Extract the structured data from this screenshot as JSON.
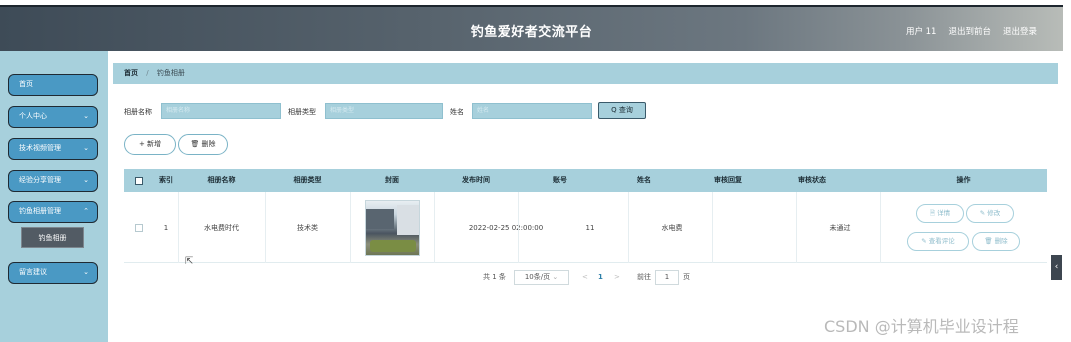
{
  "header": {
    "title": "钓鱼爱好者交流平台",
    "user": "用户 11",
    "back_to_front": "退出到前台",
    "logout": "退出登录"
  },
  "sidebar": {
    "items": [
      {
        "label": "首页",
        "chevron": ""
      },
      {
        "label": "个人中心",
        "chevron": "⌄"
      },
      {
        "label": "技术视频管理",
        "chevron": "⌄"
      },
      {
        "label": "经验分享管理",
        "chevron": "⌄"
      },
      {
        "label": "钓鱼相册管理",
        "chevron": "⌃"
      },
      {
        "label": "留言建议",
        "chevron": "⌄"
      }
    ],
    "sub_item": "钓鱼相册"
  },
  "breadcrumb": {
    "home": "首页",
    "sep": "/",
    "current": "钓鱼相册"
  },
  "search": {
    "name_label": "相册名称",
    "name_placeholder": "相册名称",
    "type_label": "相册类型",
    "type_placeholder": "相册类型",
    "person_label": "姓名",
    "person_placeholder": "姓名",
    "query_button": "Q 查询"
  },
  "actions": {
    "add": "+ 新增",
    "delete": "🗑 删除"
  },
  "table": {
    "columns": [
      "",
      "索引",
      "相册名称",
      "相册类型",
      "封面",
      "发布时间",
      "账号",
      "姓名",
      "审核回复",
      "审核状态",
      "操作"
    ],
    "rows": [
      {
        "index": "1",
        "album_name": "水电费时代",
        "album_type": "技术类",
        "publish_time": "2022-02-25 02:00:00",
        "account": "11",
        "name": "水电费",
        "reply": "",
        "status": "未通过",
        "ops": {
          "detail": "🗎 详情",
          "edit": "✎ 修改",
          "comments": "✎ 查看评论",
          "remove": "🗑 删除"
        }
      }
    ]
  },
  "pagination": {
    "total": "共 1 条",
    "page_size": "10条/页",
    "prev": "<",
    "current": "1",
    "next": ">",
    "goto_label": "前往",
    "goto_value": "1",
    "page_unit": "页"
  },
  "collapse_handle": "‹",
  "watermark": "CSDN @计算机毕业设计程"
}
